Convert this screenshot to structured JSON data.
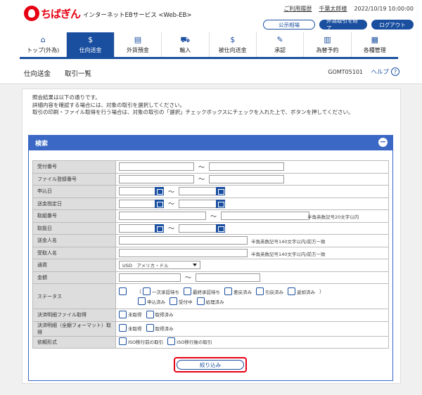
{
  "header": {
    "logo_text": "ちばぎん",
    "service_name": "インターネットEBサービス <Web-EB>",
    "links": {
      "usage_history": "ご利用履歴",
      "user_name": "千葉太郎様",
      "datetime": "2022/10/19 10:00:00"
    },
    "buttons": {
      "rates": "公示相場",
      "end_fx": "外為取引を終了",
      "logout": "ログアウト"
    }
  },
  "nav": [
    {
      "label": "トップ(外為)",
      "icon": "home-icon",
      "glyph": "⌂",
      "active": false
    },
    {
      "label": "仕向送金",
      "icon": "remittance-icon",
      "glyph": "$",
      "active": true
    },
    {
      "label": "外貨預金",
      "icon": "deposit-icon",
      "glyph": "▤",
      "active": false
    },
    {
      "label": "輸入",
      "icon": "import-icon",
      "glyph": "⛟",
      "active": false
    },
    {
      "label": "被仕向送金",
      "icon": "incoming-remittance-icon",
      "glyph": "$",
      "active": false
    },
    {
      "label": "承認",
      "icon": "approval-icon",
      "glyph": "✎",
      "active": false
    },
    {
      "label": "為替予約",
      "icon": "fx-contract-icon",
      "glyph": "▥",
      "active": false
    },
    {
      "label": "各種管理",
      "icon": "management-icon",
      "glyph": "▦",
      "active": false
    }
  ],
  "title": {
    "section": "仕向送金",
    "page": "取引一覧",
    "screen_id": "GOMT05101",
    "help": "ヘルプ"
  },
  "info_lines": [
    "照会結果は以下の通りです。",
    "詳細内容を確認する場合には、対象の取引を選択してください。",
    "取引の印刷・ファイル取得を行う場合は、対象の取引の「選択」チェックボックスにチェックを入れた上で、ボタンを押してください。"
  ],
  "search": {
    "title": "検索",
    "labels": {
      "receipt_no": "受付番号",
      "file_no": "ファイル登録番号",
      "apply_date": "申込日",
      "send_date": "送金指定日",
      "ref_no": "取組番号",
      "trade_date": "取扱日",
      "sender": "送金人名",
      "receiver": "受取人名",
      "currency": "通貨",
      "amount": "金額",
      "status": "ステータス",
      "detail_file": "決済明細ファイル取得",
      "detail_full": "決済明細（全銀フォーマット）取得",
      "request_type": "依頼形式"
    },
    "tilde": "～",
    "notes": {
      "ref_no": "半角英数記号20文字以内",
      "sender": "半角英数記号140文字以内/前方一致",
      "receiver": "半角英数記号140文字以内/前方一致"
    },
    "currency_value": "USD　アメリカ・ドル",
    "status_paren_open": "（",
    "status_paren_close": "）",
    "status_row1": [
      "一次承認待ち",
      "最終承認待ち",
      "差戻済み",
      "引戻済み",
      "返却済み"
    ],
    "status_row2": [
      "申込済み",
      "受付中",
      "処理済み"
    ],
    "detail_file_opts": [
      "未取得",
      "取得済み"
    ],
    "detail_full_opts": [
      "未取得",
      "取得済み"
    ],
    "request_opts": [
      "ISO移行前の取引",
      "ISO移行後の取引"
    ],
    "search_button": "絞り込み"
  }
}
